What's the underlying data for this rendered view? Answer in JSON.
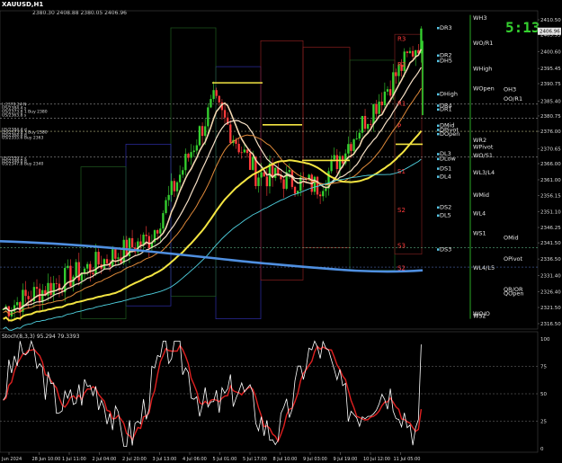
{
  "chart": {
    "symbol": "XAUUSD,H1",
    "ohlc": "2380.30 2408.88 2380.05 2406.96",
    "clock": "5:13",
    "price_axis": [
      "2410.50",
      "2405.95",
      "2400.60",
      "2395.45",
      "2390.75",
      "2385.40",
      "2380.75",
      "2376.00",
      "2370.65",
      "2366.00",
      "2361.00",
      "2356.15",
      "2351.10",
      "2346.25",
      "2341.50",
      "2336.50",
      "2331.40",
      "2326.40",
      "2321.50",
      "2316.50"
    ],
    "current_price_tag": "2406.96",
    "time_axis": [
      "Jun 2024",
      "28 Jun 10:00",
      "1 Jul 11:00",
      "2 Jul 04:00",
      "2 Jul 20:00",
      "3 Jul 13:00",
      "4 Jul 06:00",
      "5 Jul 01:00",
      "5 Jul 17:00",
      "8 Jul 10:00",
      "9 Jul 03:00",
      "9 Jul 19:00",
      "10 Jul 12:00",
      "11 Jul 05:00"
    ],
    "left_level_labels": [
      "L:2370.24 N -",
      "US/2384.4 s",
      "US/2373.8 1 Buy 2380",
      "US/2363.8 s",
      "US/2384.4 d",
      "US/2373.8 3 Buy 2380",
      "US/2364.4 d",
      "US/2355.6 Buy 2363",
      "US/2359.1 s",
      "US/2348.0 d",
      "US/2347.8 Buy 2340"
    ],
    "daily_pivots": [
      "DR3",
      "DR2",
      "DH5",
      "DHigh",
      "DR4",
      "DR1",
      "DMid",
      "DPivot",
      "DOpen",
      "DL3",
      "DLow",
      "DS1",
      "DL4",
      "DS2",
      "DL5",
      "DS3"
    ],
    "weekly_pivots": [
      "WH3",
      "WO/R1",
      "WHigh",
      "WOpen",
      "WR2",
      "WPivot",
      "WO/S1",
      "WL3/L4",
      "WMid",
      "WL4",
      "WS1",
      "WL4/L5",
      "WO/O",
      "WS2"
    ],
    "other_pivots": [
      "OH3",
      "OO/R1",
      "OMid",
      "OPivot",
      "QR/OR",
      "QOpen"
    ],
    "session_letters": [
      "R3",
      "R2",
      "R1",
      "P",
      "S1",
      "S2",
      "S3",
      "S2"
    ],
    "indicator": {
      "title": "Stoch(8,3,3) 95.294 79.3393",
      "levels": [
        "100",
        "75",
        "50",
        "25",
        "0"
      ]
    },
    "colors": {
      "background": "#000000",
      "bull": "#35d12f",
      "bear": "#ff3b3b",
      "ma_yellow": "#f4e542",
      "ma_blue": "#4f8fe0",
      "ma_cyan": "#4fd1e0",
      "ma_orange": "#e08a3a",
      "ma_pale": "#f2d6b0",
      "stoch_main": "#ffffff",
      "stoch_signal": "#e02020"
    }
  }
}
